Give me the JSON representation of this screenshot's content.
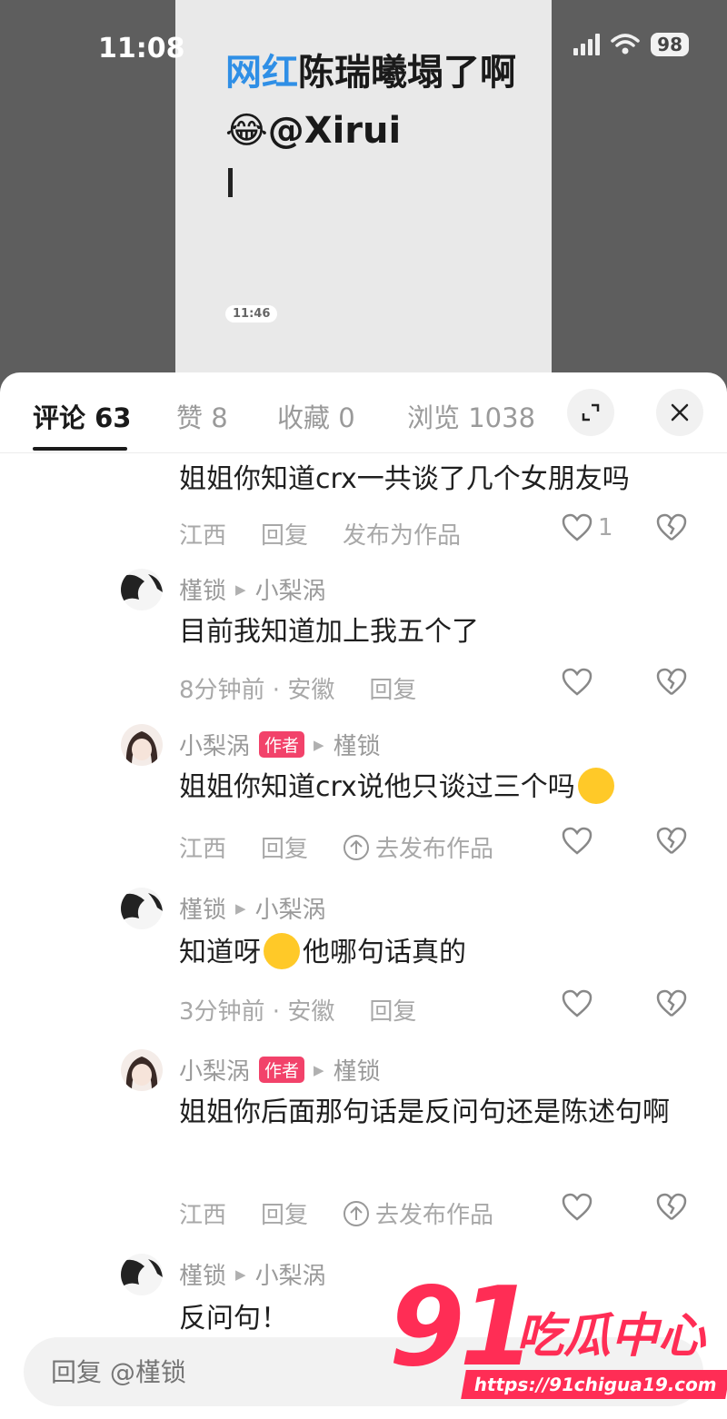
{
  "status_bar": {
    "time": "11:08",
    "battery": "98"
  },
  "video": {
    "title_highlight": "网红",
    "title_rest": "陈瑞曦塌了啊😂@Xirui",
    "timestamp": "11:46"
  },
  "tabs": [
    {
      "label": "评论 63"
    },
    {
      "label": "赞 8"
    },
    {
      "label": "收藏 0"
    },
    {
      "label": "浏览 1038"
    }
  ],
  "comments": [
    {
      "text": "姐姐你知道crx一共谈了几个女朋友吗",
      "meta_time": "",
      "location": "江西",
      "reply": "回复",
      "publish": "发布为作品",
      "likes": "1"
    },
    {
      "author": "槿锁",
      "reply_to": "小梨涡",
      "text": "目前我知道加上我五个了",
      "meta_time": "8分钟前 · 安徽",
      "reply": "回复"
    },
    {
      "author": "小梨涡",
      "badge": "作者",
      "reply_to": "槿锁",
      "text": "姐姐你知道crx说他只谈过三个吗",
      "location": "江西",
      "reply": "回复",
      "publish": "去发布作品"
    },
    {
      "author": "槿锁",
      "reply_to": "小梨涡",
      "text_before": "知道呀",
      "text_after": "他哪句话真的",
      "meta_time": "3分钟前 · 安徽",
      "reply": "回复"
    },
    {
      "author": "小梨涡",
      "badge": "作者",
      "reply_to": "槿锁",
      "text": "姐姐你后面那句话是反问句还是陈述句啊",
      "location": "江西",
      "reply": "回复",
      "publish": "去发布作品"
    },
    {
      "author": "槿锁",
      "reply_to": "小梨涡",
      "text": "反问句！"
    }
  ],
  "input": {
    "placeholder": "回复 @槿锁"
  },
  "watermark": {
    "number": "91",
    "name": "吃瓜中心",
    "url": "https://91chigua19.com"
  },
  "colors": {
    "accent": "#f2426a",
    "highlight": "#2f8fe6"
  }
}
